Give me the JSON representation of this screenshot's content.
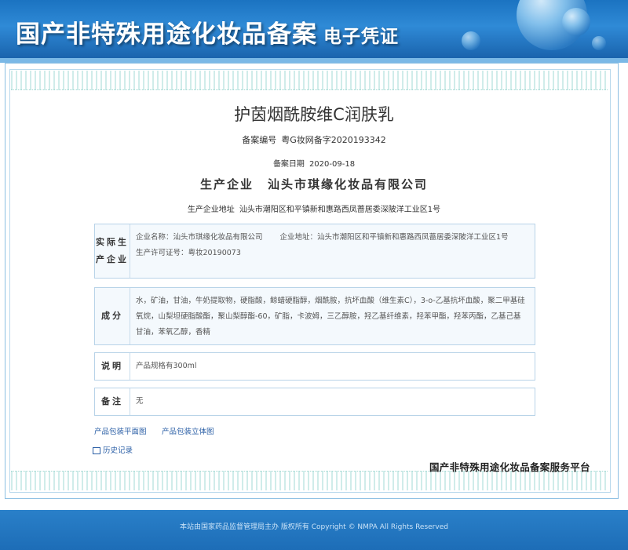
{
  "header": {
    "title": "国产非特殊用途化妆品备案",
    "subtitle": "电子凭证"
  },
  "product": {
    "name": "护茵烟酰胺维C润肤乳",
    "record_no_label": "备案编号",
    "record_no": "粤G妆网备字2020193342",
    "record_date_label": "备案日期",
    "record_date": "2020-09-18",
    "producer_label": "生产企业",
    "producer": "汕头市琪缘化妆品有限公司",
    "producer_address_label": "生产企业地址",
    "producer_address": "汕头市潮阳区和平镇新和惠路西凤蔷居委深陂洋工业区1号"
  },
  "sections": {
    "actual_producer": {
      "label": "实际生产企业",
      "company_name_label": "企业名称：",
      "company_name": "汕头市琪缘化妆品有限公司",
      "company_address_label": "企业地址：",
      "company_address": "汕头市潮阳区和平镇新和惠路西凤蔷居委深陂洋工业区1号",
      "license_label": "生产许可证号：",
      "license": "粤妆20190073"
    },
    "ingredients": {
      "label": "成分",
      "text": "水，矿油，甘油，牛奶提取物，硬脂酸，鲸蜡硬脂醇，烟酰胺，抗坏血酸（维生素C），3-o-乙基抗坏血酸，聚二甲基硅氧烷，山梨坦硬脂酸酯，聚山梨醇酯-60，矿脂，卡波姆，三乙醇胺，羟乙基纤维素，羟苯甲酯，羟苯丙酯，乙基己基甘油，苯氧乙醇，香精"
    },
    "description": {
      "label": "说明",
      "text": "产品规格有300ml"
    },
    "remark": {
      "label": "备注",
      "text": "无"
    }
  },
  "links": {
    "flat_image": "产品包装平面图",
    "stereo_image": "产品包装立体图",
    "history": "历史记录"
  },
  "platform_name": "国产非特殊用途化妆品备案服务平台",
  "footer": {
    "text": "本站由国家药品监督管理局主办 版权所有 Copyright © NMPA All Rights Reserved"
  }
}
